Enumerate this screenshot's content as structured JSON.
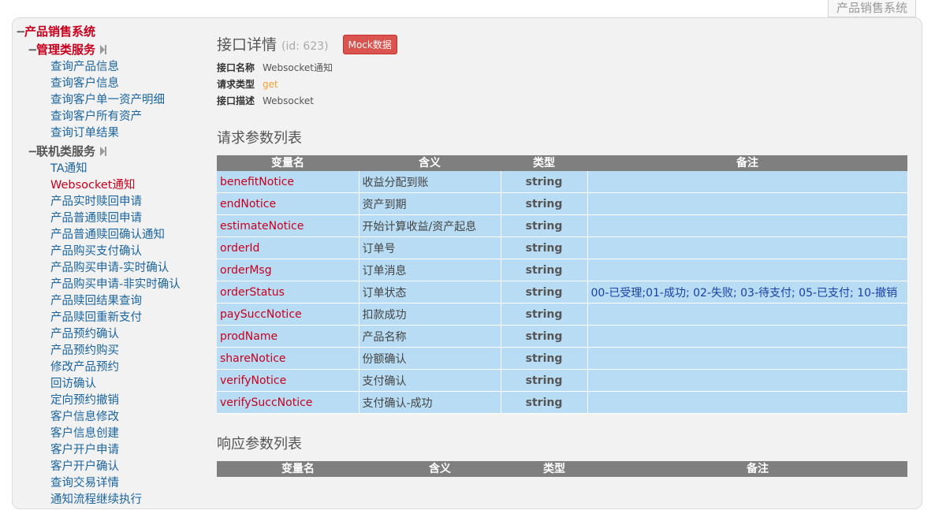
{
  "top_tab": {
    "label": "产品销售系统"
  },
  "sidebar": {
    "root": "产品销售系统",
    "groups": [
      {
        "label": "管理类服务",
        "items": [
          "查询产品信息",
          "查询客户信息",
          "查询客户单一资产明细",
          "查询客户所有资产",
          "查询订单结果"
        ]
      },
      {
        "label": "联机类服务",
        "items": [
          "TA通知",
          "Websocket通知",
          "产品实时赎回申请",
          "产品普通赎回申请",
          "产品普通赎回确认通知",
          "产品购买支付确认",
          "产品购买申请-实时确认",
          "产品购买申请-非实时确认",
          "产品赎回结果查询",
          "产品赎回重新支付",
          "产品预约确认",
          "产品预约购买",
          "修改产品预约",
          "回访确认",
          "定向预约撤销",
          "客户信息修改",
          "客户信息创建",
          "客户开户申请",
          "客户开户确认",
          "查询交易详情",
          "通知流程继续执行"
        ]
      }
    ],
    "active_item": "Websocket通知"
  },
  "main": {
    "title": "接口详情",
    "id_text": "(id: 623)",
    "mock_button": "Mock数据",
    "meta": [
      {
        "key": "接口名称",
        "value": "Websocket通知"
      },
      {
        "key": "请求类型",
        "value": "get"
      },
      {
        "key": "接口描述",
        "value": "Websocket"
      }
    ],
    "request_section_title": "请求参数列表",
    "response_section_title": "响应参数列表",
    "columns": [
      "变量名",
      "含义",
      "类型",
      "备注"
    ],
    "request_params": [
      {
        "name": "benefitNotice",
        "meaning": "收益分配到账",
        "type": "string",
        "remark": ""
      },
      {
        "name": "endNotice",
        "meaning": "资产到期",
        "type": "string",
        "remark": ""
      },
      {
        "name": "estimateNotice",
        "meaning": "开始计算收益/资产起息",
        "type": "string",
        "remark": ""
      },
      {
        "name": "orderId",
        "meaning": "订单号",
        "type": "string",
        "remark": ""
      },
      {
        "name": "orderMsg",
        "meaning": "订单消息",
        "type": "string",
        "remark": ""
      },
      {
        "name": "orderStatus",
        "meaning": "订单状态",
        "type": "string",
        "remark": "00-已受理;01-成功; 02-失败; 03-待支付; 05-已支付; 10-撤销"
      },
      {
        "name": "paySuccNotice",
        "meaning": "扣款成功",
        "type": "string",
        "remark": ""
      },
      {
        "name": "prodName",
        "meaning": "产品名称",
        "type": "string",
        "remark": ""
      },
      {
        "name": "shareNotice",
        "meaning": "份额确认",
        "type": "string",
        "remark": ""
      },
      {
        "name": "verifyNotice",
        "meaning": "支付确认",
        "type": "string",
        "remark": ""
      },
      {
        "name": "verifySuccNotice",
        "meaning": "支付确认-成功",
        "type": "string",
        "remark": ""
      }
    ]
  }
}
